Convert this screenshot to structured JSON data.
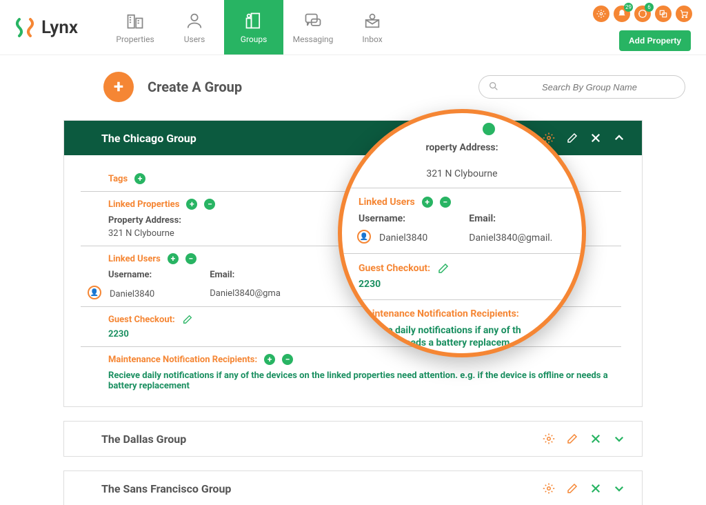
{
  "brand": {
    "name": "Lynx"
  },
  "nav": {
    "properties": "Properties",
    "users": "Users",
    "groups": "Groups",
    "messaging": "Messaging",
    "inbox": "Inbox"
  },
  "notif_badge": "29",
  "help_badge": "6",
  "add_property": "Add Property",
  "page": {
    "title": "Create A Group",
    "search_placeholder": "Search By Group Name"
  },
  "group": {
    "title": "The Chicago Group",
    "tags_label": "Tags",
    "linked_props_label": "Linked Properties",
    "prop_addr_label": "Property Address:",
    "prop_addr_value": "321 N Clybourne",
    "linked_users_label": "Linked Users",
    "username_label": "Username:",
    "email_label": "Email:",
    "username_value": "Daniel3840",
    "email_value": "Daniel3840@gma",
    "guest_checkout_label": "Guest Checkout:",
    "guest_checkout_value": "2230",
    "maint_label": "Maintenance Notification Recipients:",
    "maint_desc": "Recieve daily notifications if any of the devices on the linked properties need attention. e.g. if the device is offline or needs a battery replacement"
  },
  "mag": {
    "top_lbl": "roperty Address:",
    "addr": "321 N Clybourne",
    "linked_users": "Linked Users",
    "username_label": "Username:",
    "email_label": "Email:",
    "username": "Daniel3840",
    "email": "Daniel3840@gmail.",
    "guest_checkout": "Guest Checkout:",
    "guest_value": "2230",
    "maint": "Maintenance Notification Recipients:",
    "maint_desc1": "Recieve daily notifications if any of th",
    "maint_desc2": "offline or needs a battery replacem"
  },
  "collapsed_groups": {
    "g1": "The Dallas Group",
    "g2": "The Sans Francisco Group"
  }
}
